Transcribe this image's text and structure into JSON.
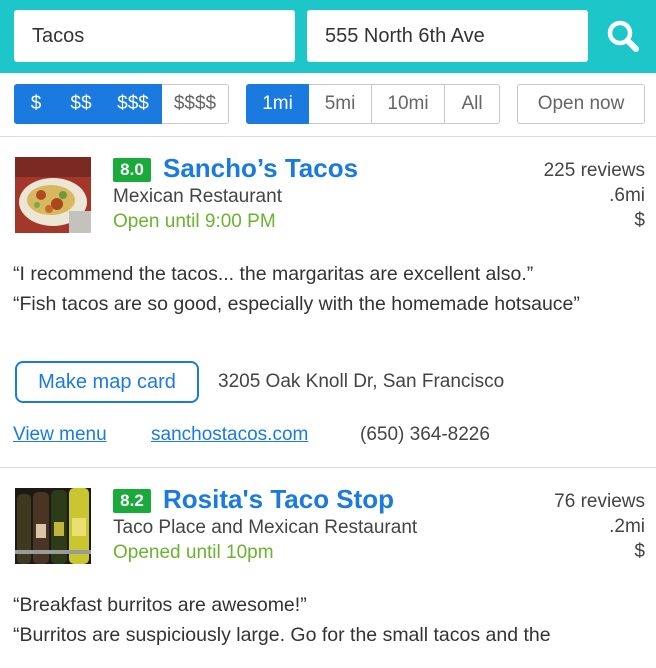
{
  "search": {
    "what_value": "Tacos",
    "where_value": "555 North 6th Ave",
    "icon": "search-icon"
  },
  "filters": {
    "price_options": [
      "$",
      "$$",
      "$$$",
      "$$$$"
    ],
    "distance_options": [
      "1mi",
      "5mi",
      "10mi",
      "All"
    ],
    "open_now_label": "Open now"
  },
  "colors": {
    "header": "#1dc7c9",
    "accent": "#1a7ae0",
    "score": "#1aaa3c",
    "open_status": "#6ab32e"
  },
  "listings": [
    {
      "score": "8.0",
      "name": "Sancho’s Tacos",
      "category": "Mexican Restaurant",
      "hours": "Open until 9:00 PM",
      "reviews": "225 reviews",
      "distance": ".6mi",
      "price": "$",
      "quotes": [
        "“I recommend the tacos... the margaritas are excellent also.”",
        "“Fish tacos are so good, especially with the homemade hotsauce”"
      ],
      "map_button": "Make map card",
      "address": "3205 Oak Knoll Dr, San Francisco",
      "menu_link": "View menu",
      "website": "sanchostacos.com",
      "phone": "(650) 364-8226"
    },
    {
      "score": "8.2",
      "name": "Rosita's Taco Stop",
      "category": "Taco Place and Mexican Restaurant",
      "hours": "Opened until 10pm",
      "reviews": "76 reviews",
      "distance": ".2mi",
      "price": "$",
      "quotes": [
        "“Breakfast burritos are awesome!”",
        "“Burritos are suspiciously large. Go for the small tacos and the"
      ]
    }
  ]
}
